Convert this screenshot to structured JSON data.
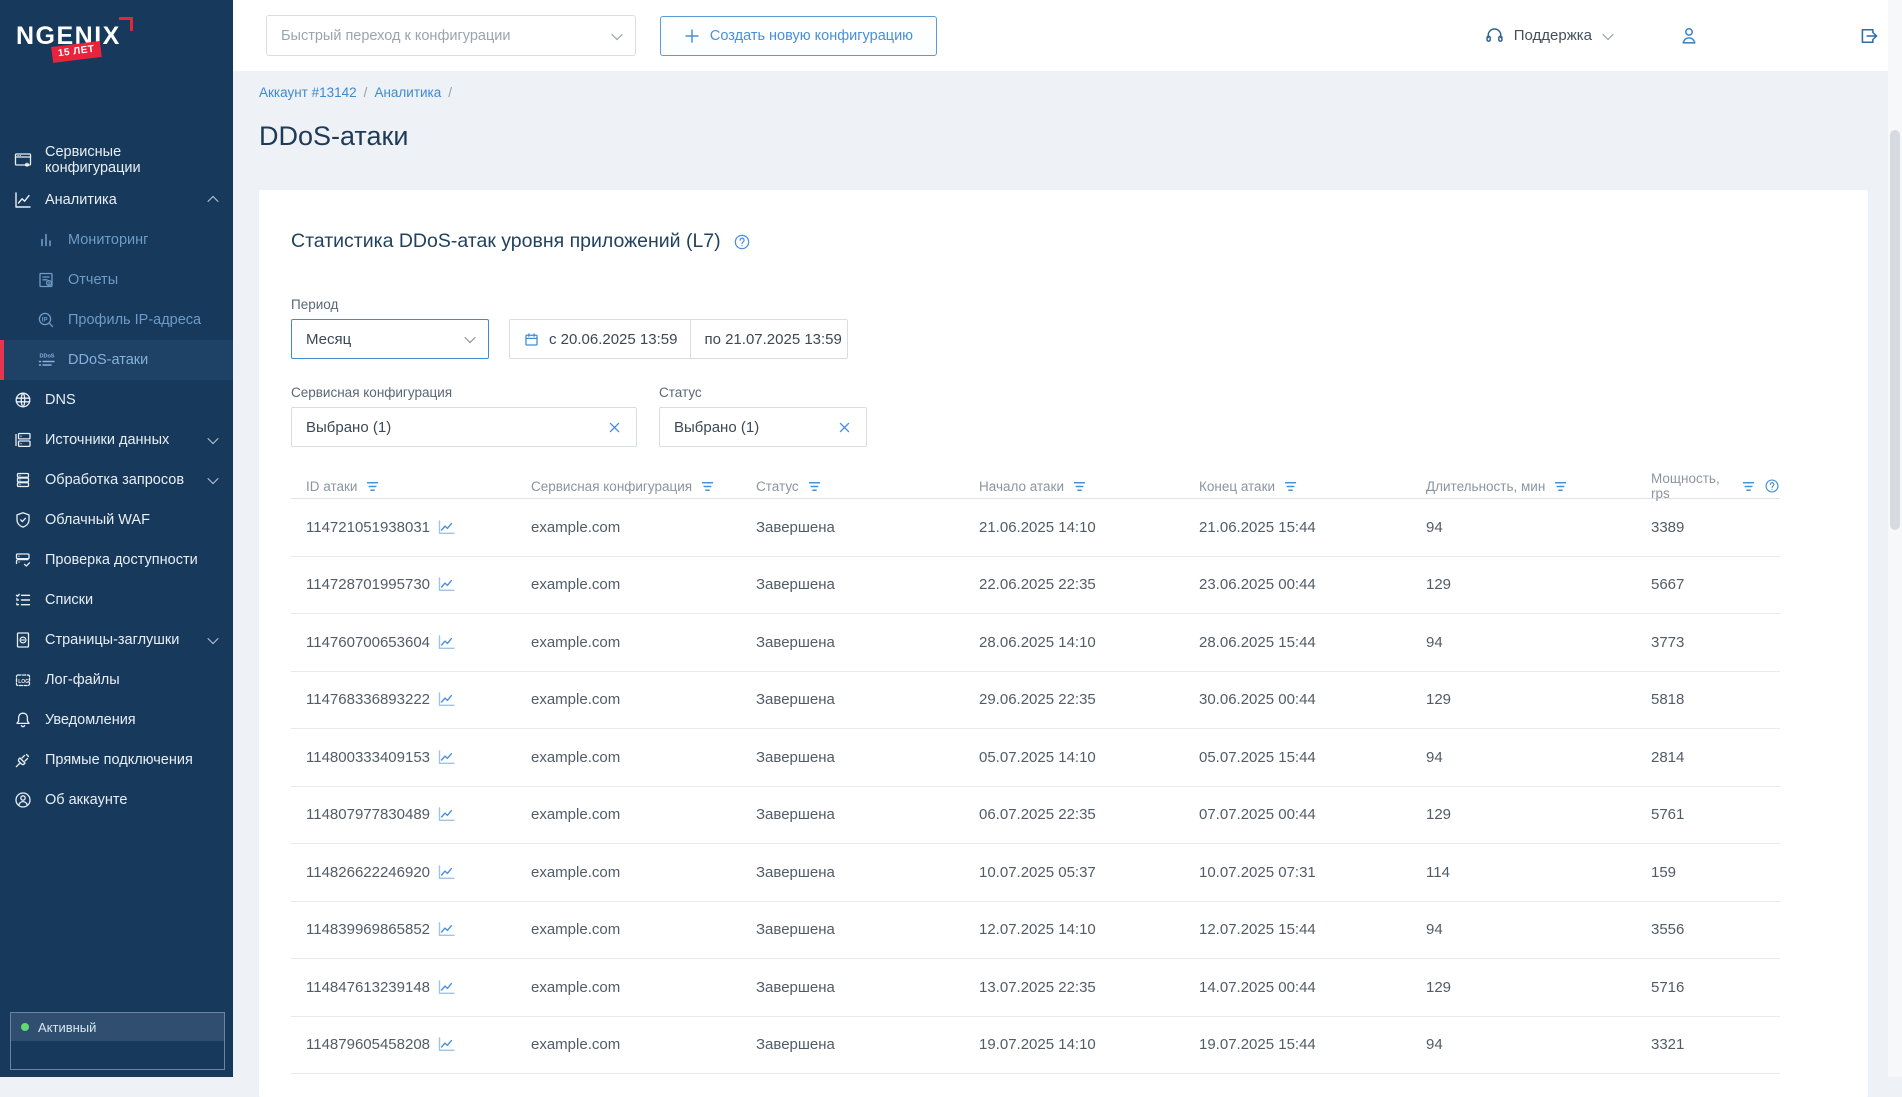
{
  "brand": {
    "name": "NGENIX",
    "badge": "15 ЛЕТ"
  },
  "colors": {
    "sidebar_bg": "#17395c",
    "accent_blue": "#3f8cd5",
    "selected_red": "#e8354f",
    "status_green": "#62d873",
    "page_bg": "#eef1f5"
  },
  "sidebar": {
    "items": [
      {
        "key": "service-configs",
        "label": "Сервисные конфигурации",
        "icon": "service-config"
      },
      {
        "key": "analytics",
        "label": "Аналитика",
        "icon": "analytics",
        "chevron": "up"
      },
      {
        "key": "monitoring",
        "label": "Мониторинг",
        "icon": "monitoring",
        "is_sub": true
      },
      {
        "key": "reports",
        "label": "Отчеты",
        "icon": "reports",
        "is_sub": true
      },
      {
        "key": "ip-profile",
        "label": "Профиль IP-адреса",
        "icon": "ip-profile",
        "is_sub": true
      },
      {
        "key": "ddos-attacks",
        "label": "DDoS-атаки",
        "icon": "ddos",
        "is_sub": true,
        "selected": true
      },
      {
        "key": "dns",
        "label": "DNS",
        "icon": "dns"
      },
      {
        "key": "data-sources",
        "label": "Источники данных",
        "icon": "data-sources",
        "chevron": "down"
      },
      {
        "key": "request-processing",
        "label": "Обработка запросов",
        "icon": "request-processing",
        "chevron": "down"
      },
      {
        "key": "cloud-waf",
        "label": "Облачный WAF",
        "icon": "waf"
      },
      {
        "key": "availability",
        "label": "Проверка доступности",
        "icon": "availability"
      },
      {
        "key": "lists",
        "label": "Списки",
        "icon": "lists"
      },
      {
        "key": "stub-pages",
        "label": "Страницы-заглушки",
        "icon": "stub-pages",
        "chevron": "down"
      },
      {
        "key": "log-files",
        "label": "Лог-файлы",
        "icon": "log-files"
      },
      {
        "key": "notifications",
        "label": "Уведомления",
        "icon": "notifications"
      },
      {
        "key": "direct-connections",
        "label": "Прямые подключения",
        "icon": "direct-connections"
      },
      {
        "key": "about-account",
        "label": "Об аккаунте",
        "icon": "account"
      }
    ],
    "account_status": "Активный"
  },
  "topbar": {
    "quick_nav_placeholder": "Быстрый переход к конфигурации",
    "create_button": "Создать новую конфигурацию",
    "support": "Поддержка"
  },
  "breadcrumb": {
    "items": [
      {
        "label": "Аккаунт #13142",
        "sep": "/"
      },
      {
        "label": "Аналитика",
        "sep": "/"
      }
    ]
  },
  "page": {
    "title": "DDoS-атаки"
  },
  "card": {
    "title": "Статистика DDoS-атак уровня приложений (L7)",
    "filters": {
      "period_label": "Период",
      "period_value": "Месяц",
      "date_from": "с 20.06.2025 13:59",
      "date_to": "по 21.07.2025 13:59",
      "service_config_label": "Сервисная конфигурация",
      "service_config_value": "Выбрано (1)",
      "status_label": "Статус",
      "status_value": "Выбрано (1)"
    }
  },
  "table": {
    "columns": [
      {
        "label": "ID атаки",
        "filter": true
      },
      {
        "label": "Сервисная конфигурация",
        "filter": true
      },
      {
        "label": "Статус",
        "filter": true
      },
      {
        "label": "Начало атаки",
        "filter": true
      },
      {
        "label": "Конец атаки",
        "filter": true
      },
      {
        "label": "Длительность, мин",
        "filter": true
      },
      {
        "label": "Мощность, rps",
        "filter": true,
        "help": true
      }
    ],
    "rows": [
      {
        "id": "114721051938031",
        "config": "example.com",
        "status": "Завершена",
        "start": "21.06.2025 14:10",
        "end": "21.06.2025 15:44",
        "duration": "94",
        "power": "3389"
      },
      {
        "id": "114728701995730",
        "config": "example.com",
        "status": "Завершена",
        "start": "22.06.2025 22:35",
        "end": "23.06.2025 00:44",
        "duration": "129",
        "power": "5667"
      },
      {
        "id": "114760700653604",
        "config": "example.com",
        "status": "Завершена",
        "start": "28.06.2025 14:10",
        "end": "28.06.2025 15:44",
        "duration": "94",
        "power": "3773"
      },
      {
        "id": "114768336893222",
        "config": "example.com",
        "status": "Завершена",
        "start": "29.06.2025 22:35",
        "end": "30.06.2025 00:44",
        "duration": "129",
        "power": "5818"
      },
      {
        "id": "114800333409153",
        "config": "example.com",
        "status": "Завершена",
        "start": "05.07.2025 14:10",
        "end": "05.07.2025 15:44",
        "duration": "94",
        "power": "2814"
      },
      {
        "id": "114807977830489",
        "config": "example.com",
        "status": "Завершена",
        "start": "06.07.2025 22:35",
        "end": "07.07.2025 00:44",
        "duration": "129",
        "power": "5761"
      },
      {
        "id": "114826622246920",
        "config": "example.com",
        "status": "Завершена",
        "start": "10.07.2025 05:37",
        "end": "10.07.2025 07:31",
        "duration": "114",
        "power": "159"
      },
      {
        "id": "114839969865852",
        "config": "example.com",
        "status": "Завершена",
        "start": "12.07.2025 14:10",
        "end": "12.07.2025 15:44",
        "duration": "94",
        "power": "3556"
      },
      {
        "id": "114847613239148",
        "config": "example.com",
        "status": "Завершена",
        "start": "13.07.2025 22:35",
        "end": "14.07.2025 00:44",
        "duration": "129",
        "power": "5716"
      },
      {
        "id": "114879605458208",
        "config": "example.com",
        "status": "Завершена",
        "start": "19.07.2025 14:10",
        "end": "19.07.2025 15:44",
        "duration": "94",
        "power": "3321"
      }
    ]
  }
}
